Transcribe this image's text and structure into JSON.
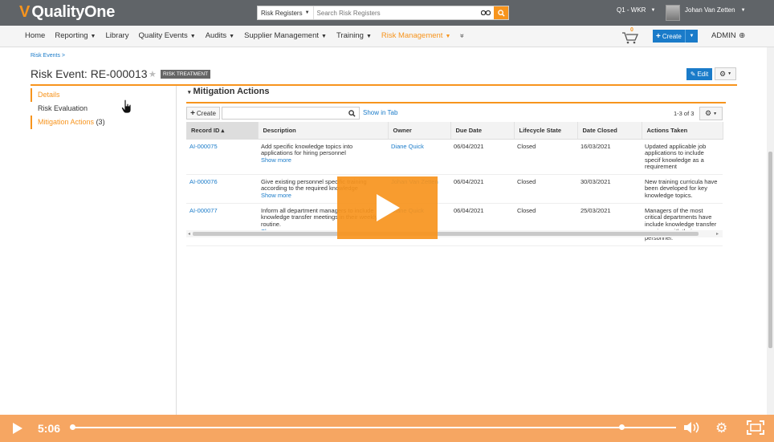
{
  "app": {
    "brand": "QualityOne",
    "search_scope": "Risk Registers",
    "search_placeholder": "Search Risk Registers",
    "period": "Q1 - WKR",
    "user_name": "Johan Van Zetten"
  },
  "nav": {
    "items": [
      {
        "label": "Home",
        "dropdown": false,
        "active": false
      },
      {
        "label": "Reporting",
        "dropdown": true,
        "active": false
      },
      {
        "label": "Library",
        "dropdown": false,
        "active": false
      },
      {
        "label": "Quality Events",
        "dropdown": true,
        "active": false
      },
      {
        "label": "Audits",
        "dropdown": true,
        "active": false
      },
      {
        "label": "Supplier Management",
        "dropdown": true,
        "active": false
      },
      {
        "label": "Training",
        "dropdown": true,
        "active": false
      },
      {
        "label": "Risk Management",
        "dropdown": true,
        "active": true
      }
    ],
    "more_icon": "double-chevron-down",
    "cart_count": "0",
    "create_label": "Create",
    "admin_label": "ADMIN"
  },
  "page": {
    "breadcrumb": "Risk Events >",
    "title": "Risk Event: RE-000013",
    "badge": "RISK TREATMENT",
    "edit_label": "Edit"
  },
  "sidebar": {
    "items": [
      {
        "label": "Details",
        "count": ""
      },
      {
        "label": "Risk Evaluation",
        "count": ""
      },
      {
        "label": "Mitigation Actions",
        "count": "(3)"
      }
    ]
  },
  "section": {
    "title": "Mitigation Actions",
    "create_label": "Create",
    "show_in_tab": "Show in Tab",
    "pager": "1-3 of 3"
  },
  "table": {
    "headers": [
      "Record ID ▴",
      "Description",
      "Owner",
      "Due Date",
      "Lifecycle State",
      "Date Closed",
      "Actions Taken"
    ],
    "rows": [
      {
        "id": "AI-000075",
        "description": "Add specific knowledge topics into applications for hiring personnel",
        "show_more": "Show more",
        "owner": "Diane Quick",
        "due": "06/04/2021",
        "state": "Closed",
        "closed": "16/03/2021",
        "actions": "Updated applicable job applications to include specif knowledge as a requirement"
      },
      {
        "id": "AI-000076",
        "description": "Give existing personnel specific training according to the required knowledge",
        "show_more": "Show more",
        "owner": "Johan Van Zetten",
        "due": "06/04/2021",
        "state": "Closed",
        "closed": "30/03/2021",
        "actions": "New training curricula have been developed for key knowledge topics."
      },
      {
        "id": "AI-000077",
        "description": "Inform all department managers to include knowledge transfer meetings in their weekly routine.",
        "show_more": "Show more",
        "owner": "Diane Quick",
        "due": "06/04/2021",
        "state": "Closed",
        "closed": "25/03/2021",
        "actions": "Managers of the most critical departments have include knowledge transfer sessions with their personnel."
      }
    ]
  },
  "video": {
    "time": "5:06",
    "progress": 0.0,
    "volume": 0.91,
    "accent": "#f7941d"
  }
}
